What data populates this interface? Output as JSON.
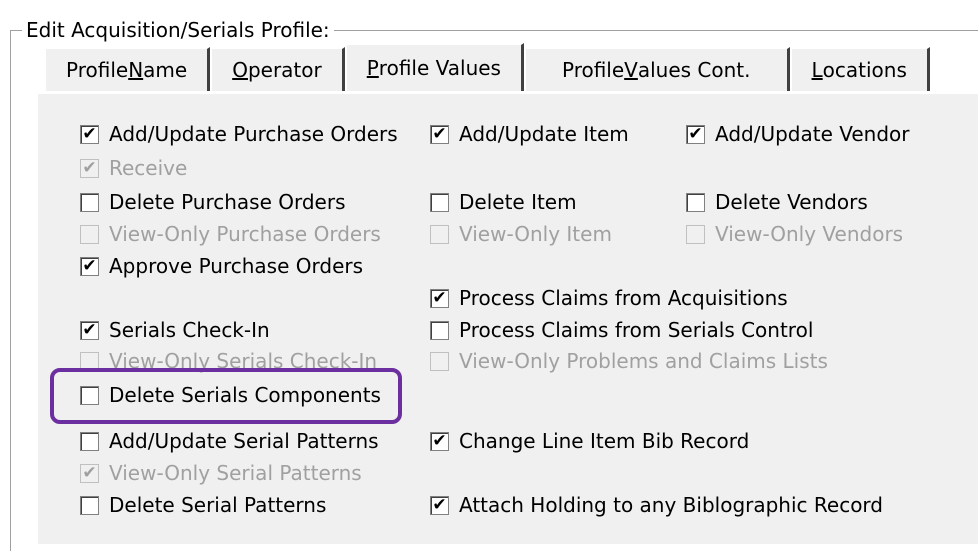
{
  "group_title": "Edit Acquisition/Serials Profile:",
  "tabs": {
    "profile_name_pre": "Profile ",
    "profile_name_u": "N",
    "profile_name_post": "ame",
    "operator_u": "O",
    "operator_post": "perator",
    "profile_values_u": "P",
    "profile_values_post": "rofile Values",
    "cont_pre": "Profile ",
    "cont_u": "V",
    "cont_post": "alues Cont.",
    "locations_u": "L",
    "locations_post": "ocations"
  },
  "checkboxes": [
    {
      "id": "c1",
      "label": "Add/Update Purchase Orders",
      "checked": true,
      "disabled": false
    },
    {
      "id": "c2",
      "label": "Receive",
      "checked": true,
      "disabled": true
    },
    {
      "id": "c3",
      "label": "Delete Purchase Orders",
      "checked": false,
      "disabled": false
    },
    {
      "id": "c4",
      "label": "View-Only Purchase Orders",
      "checked": false,
      "disabled": true
    },
    {
      "id": "c5",
      "label": "Approve Purchase Orders",
      "checked": true,
      "disabled": false
    },
    {
      "id": "c6",
      "label": "Serials Check-In",
      "checked": true,
      "disabled": false
    },
    {
      "id": "c7",
      "label": "View-Only Serials Check-In",
      "checked": false,
      "disabled": true
    },
    {
      "id": "c8",
      "label": "Delete Serials Components",
      "checked": false,
      "disabled": false
    },
    {
      "id": "c9",
      "label": "Add/Update Serial Patterns",
      "checked": false,
      "disabled": false
    },
    {
      "id": "c10",
      "label": "View-Only Serial Patterns",
      "checked": true,
      "disabled": true
    },
    {
      "id": "c11",
      "label": "Delete Serial Patterns",
      "checked": false,
      "disabled": false
    },
    {
      "id": "c12",
      "label": "Add/Update Item",
      "checked": true,
      "disabled": false
    },
    {
      "id": "c13",
      "label": "Delete Item",
      "checked": false,
      "disabled": false
    },
    {
      "id": "c14",
      "label": "View-Only Item",
      "checked": false,
      "disabled": true
    },
    {
      "id": "c15",
      "label": "Process Claims from Acquisitions",
      "checked": true,
      "disabled": false
    },
    {
      "id": "c16",
      "label": "Process Claims from Serials Control",
      "checked": false,
      "disabled": false
    },
    {
      "id": "c17",
      "label": "View-Only Problems and Claims Lists",
      "checked": false,
      "disabled": true
    },
    {
      "id": "c18",
      "label": "Change Line Item Bib Record",
      "checked": true,
      "disabled": false
    },
    {
      "id": "c19",
      "label": "Attach Holding to any Biblographic Record",
      "checked": true,
      "disabled": false
    },
    {
      "id": "c20",
      "label": "Add/Update Vendor",
      "checked": true,
      "disabled": false
    },
    {
      "id": "c21",
      "label": "Delete Vendors",
      "checked": false,
      "disabled": false
    },
    {
      "id": "c22",
      "label": "View-Only Vendors",
      "checked": false,
      "disabled": true
    }
  ],
  "colors": {
    "highlight": "#6b2fa0",
    "disabled_text": "#a0a0a0",
    "panel_bg": "#f0f0f0"
  }
}
